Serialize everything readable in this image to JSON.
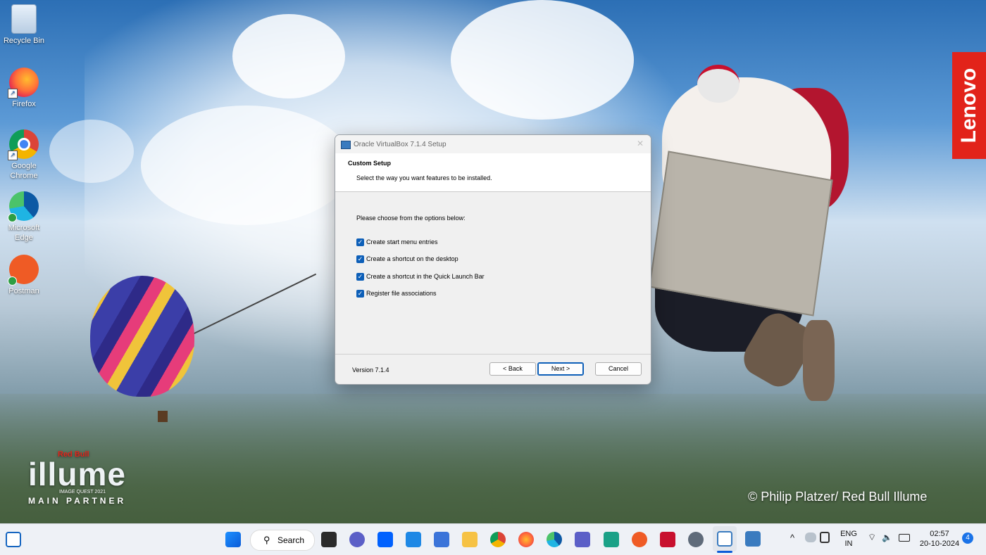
{
  "desktop": {
    "icons": [
      {
        "label": "Recycle Bin"
      },
      {
        "label": "Firefox"
      },
      {
        "label": "Google Chrome"
      },
      {
        "label": "Microsoft Edge"
      },
      {
        "label": "Postman"
      }
    ],
    "wallpaper": {
      "brand_line1": "Red Bull",
      "brand_big": "illume",
      "brand_sub": "IMAGE QUEST 2021",
      "brand_partner": "MAIN PARTNER",
      "credit": "© Philip Platzer/ Red Bull Illume",
      "lenovo": "Lenovo"
    }
  },
  "dialog": {
    "title": "Oracle VirtualBox 7.1.4 Setup",
    "close_glyph": "✕",
    "header_title": "Custom Setup",
    "header_subtitle": "Select the way you want features to be installed.",
    "prompt": "Please choose from the options below:",
    "options": [
      {
        "label": "Create start menu entries",
        "checked": true
      },
      {
        "label": "Create a shortcut on the desktop",
        "checked": true
      },
      {
        "label": "Create a shortcut in the Quick Launch Bar",
        "checked": true
      },
      {
        "label": "Register file associations",
        "checked": true
      }
    ],
    "version": "Version 7.1.4",
    "back_label": "< Back",
    "next_label": "Next >",
    "cancel_label": "Cancel"
  },
  "taskbar": {
    "search_label": "Search",
    "search_icon": "magnifier-icon",
    "lang_line1": "ENG",
    "lang_line2": "IN",
    "time": "02:57",
    "date": "20-10-2024",
    "notification_count": "4"
  },
  "colors": {
    "accent": "#0d5fb8",
    "lenovo_red": "#e2231a"
  }
}
